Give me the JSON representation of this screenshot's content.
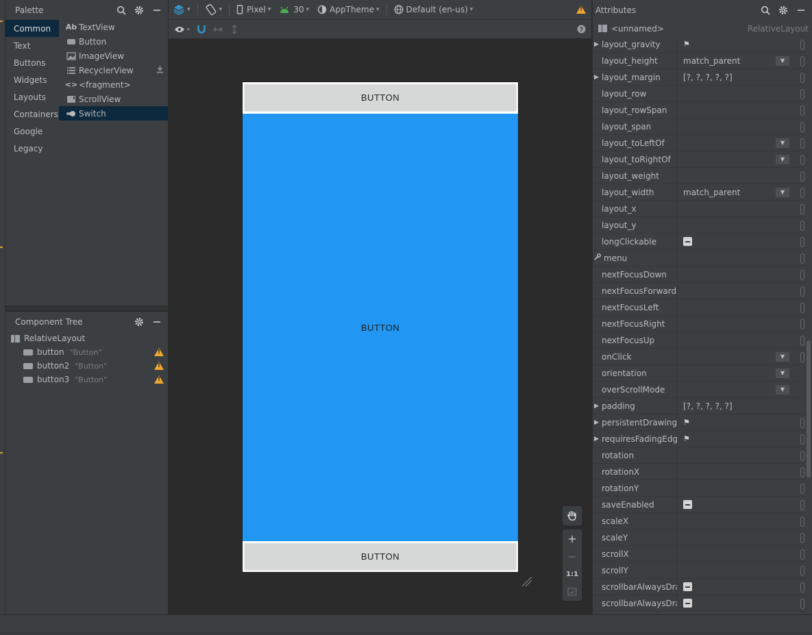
{
  "palette": {
    "title": "Palette",
    "categories": [
      "Common",
      "Text",
      "Buttons",
      "Widgets",
      "Layouts",
      "Containers",
      "Google",
      "Legacy"
    ],
    "selected_category": "Common",
    "items": [
      {
        "icon": "Ab",
        "label": "TextView"
      },
      {
        "icon": "button-icon",
        "label": "Button"
      },
      {
        "icon": "image-icon",
        "label": "ImageView"
      },
      {
        "icon": "list-icon",
        "label": "RecyclerView"
      },
      {
        "icon": "<>",
        "label": "<fragment>"
      },
      {
        "icon": "scroll-icon",
        "label": "ScrollView"
      },
      {
        "icon": "switch-icon",
        "label": "Switch"
      }
    ],
    "selected_item": "Switch"
  },
  "tree": {
    "title": "Component Tree",
    "root": "RelativeLayout",
    "children": [
      {
        "id": "button",
        "text": "\"Button\""
      },
      {
        "id": "button2",
        "text": "\"Button\""
      },
      {
        "id": "button3",
        "text": "\"Button\""
      }
    ]
  },
  "toolbar": {
    "device": "Pixel",
    "api": "30",
    "theme": "AppTheme",
    "locale": "Default (en-us)"
  },
  "device_preview": {
    "top_button": "BUTTON",
    "middle_button": "BUTTON",
    "bottom_button": "BUTTON",
    "middle_color": "#2196f3"
  },
  "zoom": {
    "plus": "+",
    "minus": "−",
    "one_to_one": "1:1"
  },
  "attributes": {
    "title": "Attributes",
    "element_name": "<unnamed>",
    "element_type": "RelativeLayout",
    "rows": [
      {
        "name": "layout_gravity",
        "expand": true,
        "value": "",
        "flag": true,
        "dropdown": false,
        "check": false
      },
      {
        "name": "layout_height",
        "expand": false,
        "value": "match_parent",
        "flag": false,
        "dropdown": true,
        "check": false
      },
      {
        "name": "layout_margin",
        "expand": true,
        "value": "[?, ?, ?, ?, ?]",
        "flag": false,
        "dropdown": false,
        "check": false
      },
      {
        "name": "layout_row",
        "expand": false,
        "value": "",
        "flag": false,
        "dropdown": false,
        "check": false
      },
      {
        "name": "layout_rowSpan",
        "expand": false,
        "value": "",
        "flag": false,
        "dropdown": false,
        "check": false
      },
      {
        "name": "layout_span",
        "expand": false,
        "value": "",
        "flag": false,
        "dropdown": false,
        "check": false
      },
      {
        "name": "layout_toLeftOf",
        "expand": false,
        "value": "",
        "flag": false,
        "dropdown": true,
        "check": false
      },
      {
        "name": "layout_toRightOf",
        "expand": false,
        "value": "",
        "flag": false,
        "dropdown": true,
        "check": false
      },
      {
        "name": "layout_weight",
        "expand": false,
        "value": "",
        "flag": false,
        "dropdown": false,
        "check": false
      },
      {
        "name": "layout_width",
        "expand": false,
        "value": "match_parent",
        "flag": false,
        "dropdown": true,
        "check": false
      },
      {
        "name": "layout_x",
        "expand": false,
        "value": "",
        "flag": false,
        "dropdown": false,
        "check": false
      },
      {
        "name": "layout_y",
        "expand": false,
        "value": "",
        "flag": false,
        "dropdown": false,
        "check": false
      },
      {
        "name": "longClickable",
        "expand": false,
        "value": "",
        "flag": false,
        "dropdown": false,
        "check": true
      },
      {
        "name": "menu",
        "expand": false,
        "value": "",
        "flag": false,
        "dropdown": false,
        "check": false,
        "wrench": true
      },
      {
        "name": "nextFocusDown",
        "expand": false,
        "value": "",
        "flag": false,
        "dropdown": false,
        "check": false
      },
      {
        "name": "nextFocusForward",
        "expand": false,
        "value": "",
        "flag": false,
        "dropdown": false,
        "check": false
      },
      {
        "name": "nextFocusLeft",
        "expand": false,
        "value": "",
        "flag": false,
        "dropdown": false,
        "check": false
      },
      {
        "name": "nextFocusRight",
        "expand": false,
        "value": "",
        "flag": false,
        "dropdown": false,
        "check": false
      },
      {
        "name": "nextFocusUp",
        "expand": false,
        "value": "",
        "flag": false,
        "dropdown": false,
        "check": false
      },
      {
        "name": "onClick",
        "expand": false,
        "value": "",
        "flag": false,
        "dropdown": true,
        "check": false
      },
      {
        "name": "orientation",
        "expand": false,
        "value": "",
        "flag": false,
        "dropdown": true,
        "check": false,
        "nopill": true
      },
      {
        "name": "overScrollMode",
        "expand": false,
        "value": "",
        "flag": false,
        "dropdown": true,
        "check": false,
        "nopill": true
      },
      {
        "name": "padding",
        "expand": true,
        "value": "[?, ?, ?, ?, ?]",
        "flag": false,
        "dropdown": false,
        "check": false,
        "nopill": true
      },
      {
        "name": "persistentDrawingC...",
        "expand": true,
        "value": "",
        "flag": true,
        "dropdown": false,
        "check": false
      },
      {
        "name": "requiresFadingEdge",
        "expand": true,
        "value": "",
        "flag": true,
        "dropdown": false,
        "check": false
      },
      {
        "name": "rotation",
        "expand": false,
        "value": "",
        "flag": false,
        "dropdown": false,
        "check": false
      },
      {
        "name": "rotationX",
        "expand": false,
        "value": "",
        "flag": false,
        "dropdown": false,
        "check": false
      },
      {
        "name": "rotationY",
        "expand": false,
        "value": "",
        "flag": false,
        "dropdown": false,
        "check": false
      },
      {
        "name": "saveEnabled",
        "expand": false,
        "value": "",
        "flag": false,
        "dropdown": false,
        "check": true
      },
      {
        "name": "scaleX",
        "expand": false,
        "value": "",
        "flag": false,
        "dropdown": false,
        "check": false
      },
      {
        "name": "scaleY",
        "expand": false,
        "value": "",
        "flag": false,
        "dropdown": false,
        "check": false
      },
      {
        "name": "scrollX",
        "expand": false,
        "value": "",
        "flag": false,
        "dropdown": false,
        "check": false
      },
      {
        "name": "scrollY",
        "expand": false,
        "value": "",
        "flag": false,
        "dropdown": false,
        "check": false
      },
      {
        "name": "scrollbarAlwaysDra...",
        "expand": false,
        "value": "",
        "flag": false,
        "dropdown": false,
        "check": true
      },
      {
        "name": "scrollbarAlwaysDra...",
        "expand": false,
        "value": "",
        "flag": false,
        "dropdown": false,
        "check": true
      }
    ]
  }
}
